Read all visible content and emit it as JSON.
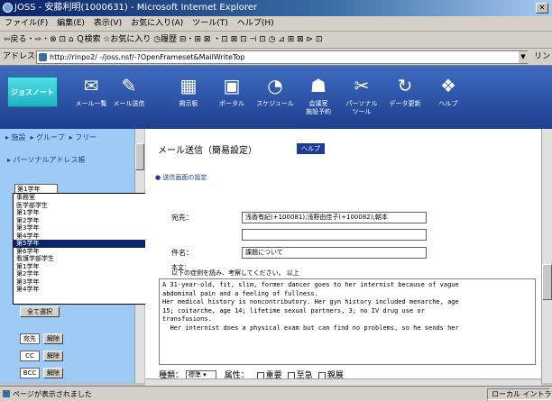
{
  "window": {
    "title": "JOSS - 安藤利明(1000631) - Microsoft Internet Explorer",
    "menu": [
      "ファイル(F)",
      "編集(E)",
      "表示(V)",
      "お気に入り(A)",
      "ツール(T)",
      "ヘルプ(H)"
    ],
    "toolbar_text": "⇦戻る・⇨・⊗ ⊡ ⌂  Ｑ検索  ☆お気に入り  ◷履歴   ⊟・⊞ ⊠ ・⊡ ⊠ ⊡  ⊣ ⊡ ◷ ⊿ ⊞ ⊠ ⊳ ⊡",
    "address_label": "アドレス(D)",
    "address_value": "http://rinpo2/ -/joss.nsf/-?OpenFrameset&MailWriteTop",
    "go_label": "リンク"
  },
  "app": {
    "logo_text": "ジョスノート",
    "tools": [
      {
        "icon": "mail-icon",
        "glyph": "✉",
        "label": "メール一覧"
      },
      {
        "icon": "mail-write-icon",
        "glyph": "✎",
        "label": "メール送信"
      },
      {
        "icon": "calendar-icon",
        "glyph": "▦",
        "label": "掲示板"
      },
      {
        "icon": "portal-icon",
        "glyph": "▣",
        "label": "ポータル"
      },
      {
        "icon": "clock-icon",
        "glyph": "◔",
        "label": "スケジュール"
      },
      {
        "icon": "meeting-icon",
        "glyph": "☗",
        "label": "会議室\n施設予約"
      },
      {
        "icon": "tools-icon",
        "glyph": "✂",
        "label": "パーソナル\nツール"
      },
      {
        "icon": "exit-icon",
        "glyph": "↻",
        "label": "データ更新"
      },
      {
        "icon": "help-book-icon",
        "glyph": "❖",
        "label": "ヘルプ"
      }
    ]
  },
  "left": {
    "tabs": [
      "▸ 施設",
      "▸ グループ",
      "▸ フリー"
    ],
    "heading": "▸ パーソナルアドレス帳",
    "select_value": "第1学年",
    "list_items": [
      "事務室",
      "医学部学生",
      "第1学年",
      "第2学年",
      "第3学年",
      "第4学年",
      "第5学年",
      "第6学年",
      "看護学部学生",
      "第1学年",
      "第2学年",
      "第3学年",
      "第4学年"
    ],
    "selected_index": 6,
    "select_all_label": "全て選択",
    "rows": [
      {
        "label": "宛先",
        "button": "解除"
      },
      {
        "label": "CC",
        "button": "解除"
      },
      {
        "label": "BCC",
        "button": "解除"
      }
    ]
  },
  "main": {
    "title": "メール送信（簡易設定）",
    "help_label": "ヘルプ",
    "section_label": "● 送信画面の設定",
    "to_label": "宛先：",
    "to_value": "浅香有紀(+100081);浅野由佳子(+100082);朝本",
    "cc_value": "",
    "subject_label": "件名：",
    "subject_value": "課題について",
    "from_label": "本文：",
    "note": "以下の症例を読み、考察してください。 以上",
    "body_lines": [
      "A 31-year-old, fit, slim, former dancer goes to her internist because of vague",
      "abdominal pain and a feeling of fullness.",
      "Her medical history is noncontributory. Her gyn history included menarche, age",
      "15; coitarche, age 14; lifetime sexual partners, 3; no IV drug use or",
      "transfusions.",
      "  Her internist does a physical exam but can find no problems, so he sends her"
    ],
    "kind_label": "種類：",
    "kind_value": "標準 ▾",
    "attr_label": "属性：",
    "attrs": [
      "重要",
      "至急",
      "親展"
    ]
  },
  "status": {
    "text": "ページが表示されました",
    "zone": "ローカル イントラネット"
  }
}
